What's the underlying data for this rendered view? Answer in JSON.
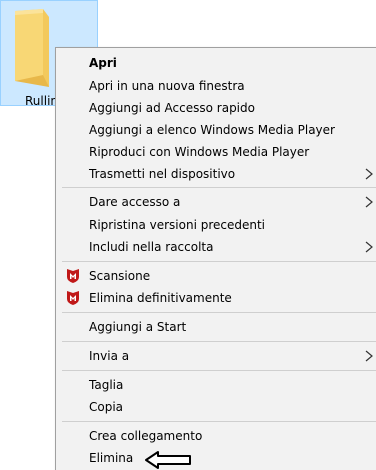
{
  "folder": {
    "label": "Rullini",
    "icon": "folder-icon"
  },
  "menu": {
    "items": [
      {
        "label": "Apri",
        "bold": true
      },
      {
        "label": "Apri in una nuova finestra"
      },
      {
        "label": "Aggiungi ad Accesso rapido"
      },
      {
        "label": "Aggiungi a elenco Windows Media Player"
      },
      {
        "label": "Riproduci con Windows Media Player"
      },
      {
        "label": "Trasmetti nel dispositivo",
        "submenu": true
      },
      {
        "label": "Dare accesso a",
        "submenu": true
      },
      {
        "label": "Ripristina versioni precedenti"
      },
      {
        "label": "Includi nella raccolta",
        "submenu": true
      },
      {
        "label": "Scansione",
        "icon": "mcafee-shield-icon"
      },
      {
        "label": "Elimina definitivamente",
        "icon": "mcafee-shield-icon"
      },
      {
        "label": "Aggiungi a Start"
      },
      {
        "label": "Invia a",
        "submenu": true
      },
      {
        "label": "Taglia"
      },
      {
        "label": "Copia"
      },
      {
        "label": "Crea collegamento"
      },
      {
        "label": "Elimina"
      }
    ]
  },
  "colors": {
    "selection": "#cce8ff",
    "menu_bg": "#f2f2f2",
    "mcafee_red": "#c01818",
    "folder_yellow": "#f8d775"
  }
}
